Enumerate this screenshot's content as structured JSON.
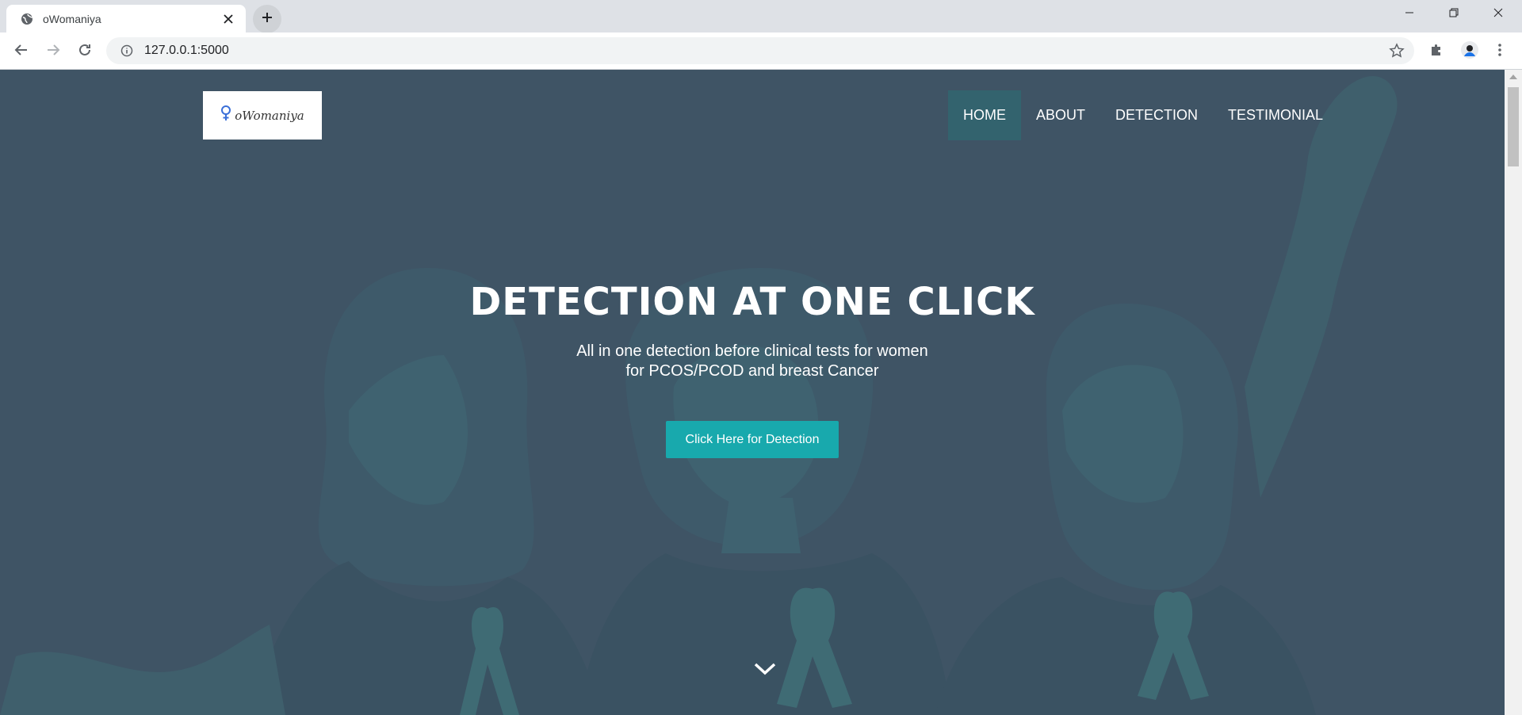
{
  "browser": {
    "tab_title": "oWomaniya",
    "url": "127.0.0.1:5000",
    "icons": {
      "favicon": "globe-icon",
      "close": "close-icon",
      "new_tab": "plus-icon",
      "back": "back-arrow-icon",
      "forward": "forward-arrow-icon",
      "reload": "reload-icon",
      "site_info": "info-icon",
      "bookmark": "star-icon",
      "extensions": "puzzle-icon",
      "profile": "avatar-icon",
      "menu": "kebab-menu-icon",
      "minimize": "minimize-icon",
      "restore": "restore-icon",
      "window_close": "window-close-icon"
    }
  },
  "site": {
    "logo_text": "oWomaniya",
    "nav": [
      {
        "label": "HOME",
        "active": true
      },
      {
        "label": "ABOUT",
        "active": false
      },
      {
        "label": "DETECTION",
        "active": false
      },
      {
        "label": "TESTIMONIAL",
        "active": false
      }
    ],
    "hero": {
      "title": "DETECTION AT ONE CLICK",
      "subtitle_line1": "All in one detection before clinical tests for women",
      "subtitle_line2": "for PCOS/PCOD and breast Cancer",
      "cta_label": "Click Here for Detection",
      "scroll_icon": "chevron-down-icon"
    },
    "colors": {
      "hero_bg": "#3f5465",
      "silhouette": "#3f5f6c",
      "accent": "#18a9ad",
      "nav_active": "#33636e"
    }
  }
}
